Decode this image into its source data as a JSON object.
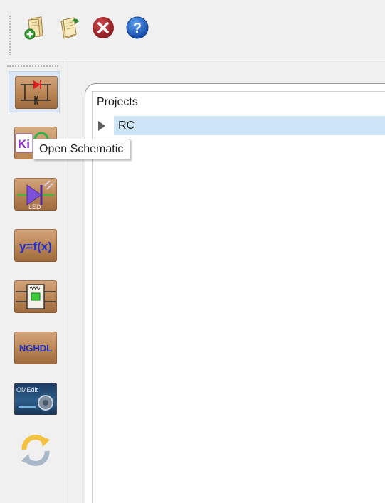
{
  "toolbar": {
    "items": [
      {
        "icon": "new-project-icon"
      },
      {
        "icon": "open-project-icon"
      },
      {
        "icon": "close-project-icon"
      },
      {
        "icon": "help-icon"
      }
    ]
  },
  "left_toolbar": {
    "items": [
      {
        "icon": "open-schematic-icon",
        "active": true
      },
      {
        "icon": "kicad-footprint-icon",
        "text": "Ki"
      },
      {
        "icon": "led-model-icon",
        "text": "LED"
      },
      {
        "icon": "function-icon",
        "text": "y=f(x)"
      },
      {
        "icon": "subcircuit-icon"
      },
      {
        "icon": "nghdl-icon",
        "text": "NGHDL"
      },
      {
        "icon": "omedit-icon",
        "text": "OMEdit"
      },
      {
        "icon": "refresh-icon"
      }
    ]
  },
  "project_panel": {
    "header": "Projects",
    "items": [
      {
        "label": "RC",
        "selected": true
      }
    ]
  },
  "tooltip": {
    "text": "Open Schematic"
  },
  "colors": {
    "selection": "#cde5f7",
    "icon_wood": "#b98454",
    "help_blue": "#1f66c9",
    "close_red": "#a3262b"
  }
}
